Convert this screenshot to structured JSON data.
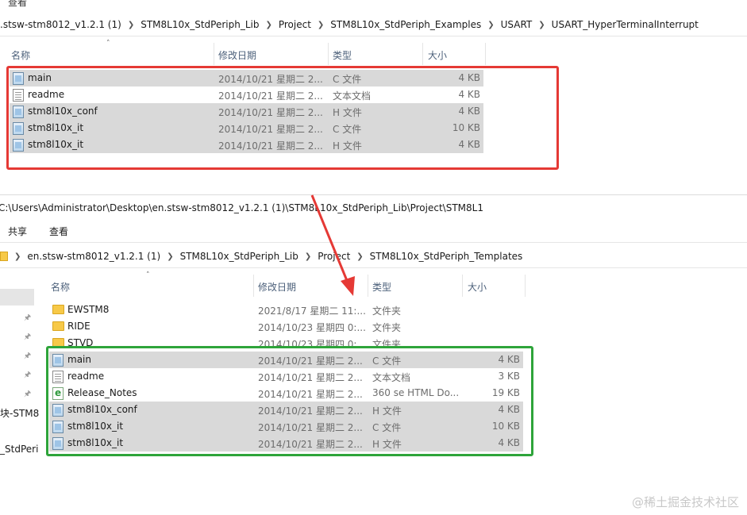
{
  "top": {
    "cut_text": "查看",
    "breadcrumb": [
      ".stsw-stm8012_v1.2.1 (1)",
      "STM8L10x_StdPeriph_Lib",
      "Project",
      "STM8L10x_StdPeriph_Examples",
      "USART",
      "USART_HyperTerminalInterrupt"
    ],
    "headers": {
      "name": "名称",
      "modified": "修改日期",
      "type": "类型",
      "size": "大小"
    },
    "rows": [
      {
        "name": "main",
        "date": "2014/10/21 星期二 2...",
        "type": "C 文件",
        "size": "4 KB",
        "icon": "c-file-icon",
        "selected": true
      },
      {
        "name": "readme",
        "date": "2014/10/21 星期二 2...",
        "type": "文本文档",
        "size": "4 KB",
        "icon": "text-file-icon",
        "selected": false
      },
      {
        "name": "stm8l10x_conf",
        "date": "2014/10/21 星期二 2...",
        "type": "H 文件",
        "size": "4 KB",
        "icon": "h-file-icon",
        "selected": true
      },
      {
        "name": "stm8l10x_it",
        "date": "2014/10/21 星期二 2...",
        "type": "C 文件",
        "size": "10 KB",
        "icon": "c-file-icon",
        "selected": true
      },
      {
        "name": "stm8l10x_it",
        "date": "2014/10/21 星期二 2...",
        "type": "H 文件",
        "size": "4 KB",
        "icon": "h-file-icon",
        "selected": true
      }
    ]
  },
  "bottom": {
    "path": "C:\\Users\\Administrator\\Desktop\\en.stsw-stm8012_v1.2.1 (1)\\STM8L10x_StdPeriph_Lib\\Project\\STM8L1",
    "menu": [
      "共享",
      "查看"
    ],
    "breadcrumb": [
      "en.stsw-stm8012_v1.2.1 (1)",
      "STM8L10x_StdPeriph_Lib",
      "Project",
      "STM8L10x_StdPeriph_Templates"
    ],
    "headers": {
      "name": "名称",
      "modified": "修改日期",
      "type": "类型",
      "size": "大小"
    },
    "nav_partial": [
      "块-STM8",
      "_StdPeri"
    ],
    "rows": [
      {
        "name": "EWSTM8",
        "date": "2021/8/17 星期二 11:...",
        "type": "文件夹",
        "size": "",
        "icon": "folder-icon",
        "selected": false
      },
      {
        "name": "RIDE",
        "date": "2014/10/23 星期四 0:...",
        "type": "文件夹",
        "size": "",
        "icon": "folder-icon",
        "selected": false
      },
      {
        "name": "STVD",
        "date": "2014/10/23 星期四 0:...",
        "type": "文件夹",
        "size": "",
        "icon": "folder-icon",
        "selected": false
      },
      {
        "name": "main",
        "date": "2014/10/21 星期二 2...",
        "type": "C 文件",
        "size": "4 KB",
        "icon": "c-file-icon",
        "selected": true
      },
      {
        "name": "readme",
        "date": "2014/10/21 星期二 2...",
        "type": "文本文档",
        "size": "3 KB",
        "icon": "text-file-icon",
        "selected": false
      },
      {
        "name": "Release_Notes",
        "date": "2014/10/21 星期二 2...",
        "type": "360 se HTML Do...",
        "size": "19 KB",
        "icon": "html-file-icon",
        "selected": false
      },
      {
        "name": "stm8l10x_conf",
        "date": "2014/10/21 星期二 2...",
        "type": "H 文件",
        "size": "4 KB",
        "icon": "h-file-icon",
        "selected": true
      },
      {
        "name": "stm8l10x_it",
        "date": "2014/10/21 星期二 2...",
        "type": "C 文件",
        "size": "10 KB",
        "icon": "c-file-icon",
        "selected": true
      },
      {
        "name": "stm8l10x_it",
        "date": "2014/10/21 星期二 2...",
        "type": "H 文件",
        "size": "4 KB",
        "icon": "h-file-icon",
        "selected": true
      }
    ]
  },
  "colors": {
    "red_box": "#e53935",
    "green_box": "#2ea43a",
    "arrow": "#e53935",
    "selected_row": "#d9d9d9"
  },
  "watermark": "@稀土掘金技术社区"
}
